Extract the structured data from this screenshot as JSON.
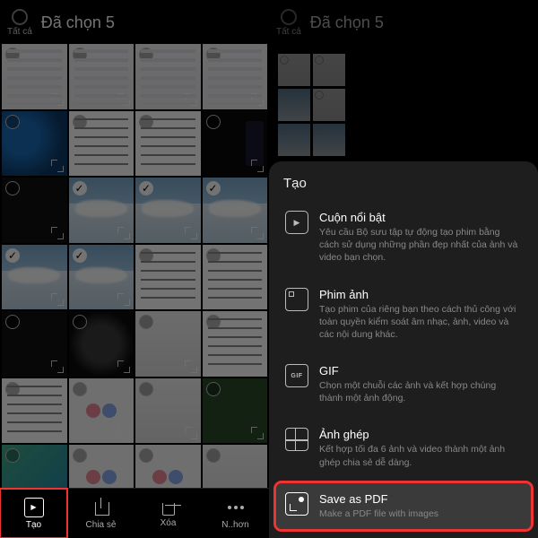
{
  "left": {
    "all_label": "Tất cả",
    "title": "Đã chọn 5",
    "bottom": {
      "create": "Tạo",
      "share": "Chia sẻ",
      "delete": "Xóa",
      "more": "N..hơn"
    }
  },
  "right": {
    "all_label": "Tất cả",
    "title": "Đã chọn 5",
    "sheet_title": "Tạo",
    "options": [
      {
        "title": "Cuộn nổi bật",
        "desc": "Yêu cầu Bộ sưu tập tự động tạo phim bằng cách sử dụng những phần đẹp nhất của ảnh và video bạn chọn."
      },
      {
        "title": "Phim ảnh",
        "desc": "Tạo phim của riêng bạn theo cách thủ công với toàn quyền kiểm soát âm nhạc, ảnh, video và các nội dung khác."
      },
      {
        "title": "GIF",
        "desc": "Chọn một chuỗi các ảnh và kết hợp chúng thành một ảnh động."
      },
      {
        "title": "Ảnh ghép",
        "desc": "Kết hợp tối đa 6 ảnh và video thành một ảnh ghép chia sẻ dễ dàng."
      },
      {
        "title": "Save as PDF",
        "desc": "Make a PDF file with images"
      }
    ]
  }
}
